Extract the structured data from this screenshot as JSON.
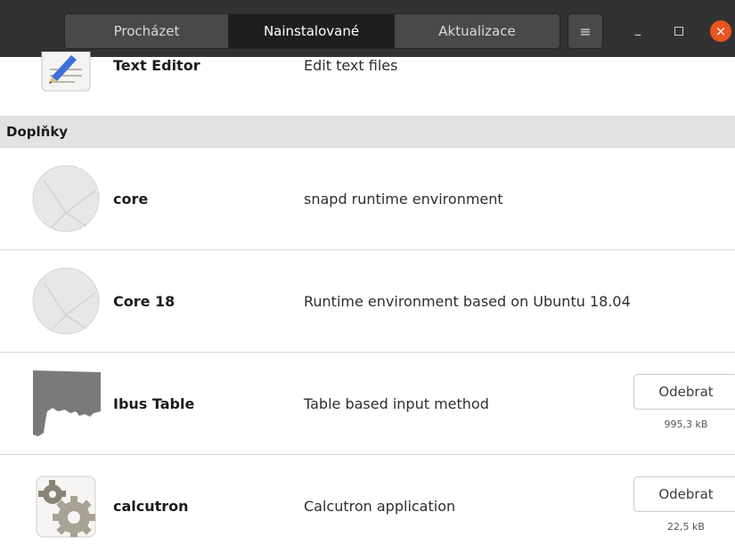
{
  "header": {
    "tabs": [
      {
        "label": "Procházet",
        "active": false
      },
      {
        "label": "Nainstalované",
        "active": true
      },
      {
        "label": "Aktualizace",
        "active": false
      }
    ],
    "menu_icon": "≡",
    "minimize_icon": "–",
    "close_icon": "×"
  },
  "apps_top": {
    "name": "Text Editor",
    "description": "Edit text files"
  },
  "addons_section": {
    "title": "Doplňky"
  },
  "addons": [
    {
      "name": "core",
      "description": "snapd runtime environment",
      "icon": "snap-placeholder-icon"
    },
    {
      "name": "Core 18",
      "description": "Runtime environment based on Ubuntu 18.04",
      "icon": "snap-placeholder-icon"
    },
    {
      "name": "Ibus Table",
      "description": "Table based input method",
      "icon": "ibus-table-icon",
      "button": "Odebrat",
      "size": "995,3 kB"
    },
    {
      "name": "calcutron",
      "description": "Calcutron application",
      "icon": "gear-icon",
      "button": "Odebrat",
      "size": "22,5 kB"
    }
  ],
  "colors": {
    "headerbar": "#333232",
    "close_button": "#e95420",
    "section_bg": "#e2e2e2"
  }
}
